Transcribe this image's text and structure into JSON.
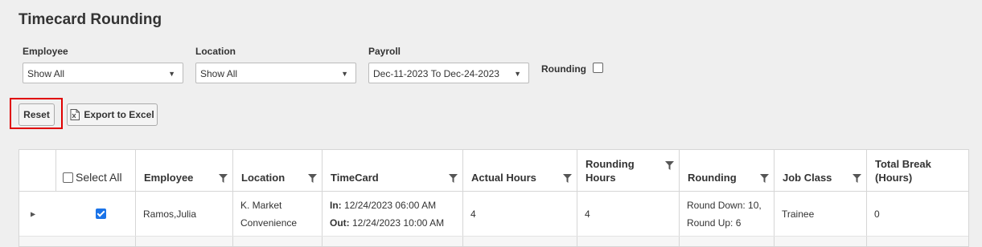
{
  "page": {
    "title": "Timecard Rounding"
  },
  "filters": {
    "employee": {
      "label": "Employee",
      "value": "Show All"
    },
    "location": {
      "label": "Location",
      "value": "Show All"
    },
    "payroll": {
      "label": "Payroll",
      "value": "Dec-11-2023 To Dec-24-2023"
    },
    "rounding": {
      "label": "Rounding",
      "checked": false
    }
  },
  "toolbar": {
    "reset_label": "Reset",
    "export_label": "Export to Excel"
  },
  "colors": {
    "highlight": "#e00000",
    "checkbox_checked": "#1a73e8"
  },
  "table": {
    "select_all_label": "Select All",
    "columns": [
      "Employee",
      "Location",
      "TimeCard",
      "Actual Hours",
      "Rounding Hours",
      "Rounding",
      "Job Class",
      "Total Break (Hours)"
    ],
    "column_lines": {
      "rounding_hours": [
        "Rounding",
        "Hours"
      ],
      "total_break": [
        "Total Break",
        "(Hours)"
      ]
    },
    "rows": [
      {
        "selected": true,
        "employee": "Ramos,Julia",
        "location_l1": "K. Market",
        "location_l2": "Convenience",
        "in_label": "In:",
        "in_value": "12/24/2023 06:00 AM",
        "out_label": "Out:",
        "out_value": "12/24/2023 10:00 AM",
        "actual_hours": "4",
        "rounding_hours": "4",
        "rounding_l1": "Round Down: 10,",
        "rounding_l2": "Round Up: 6",
        "job_class": "Trainee",
        "total_break": "0"
      }
    ]
  }
}
